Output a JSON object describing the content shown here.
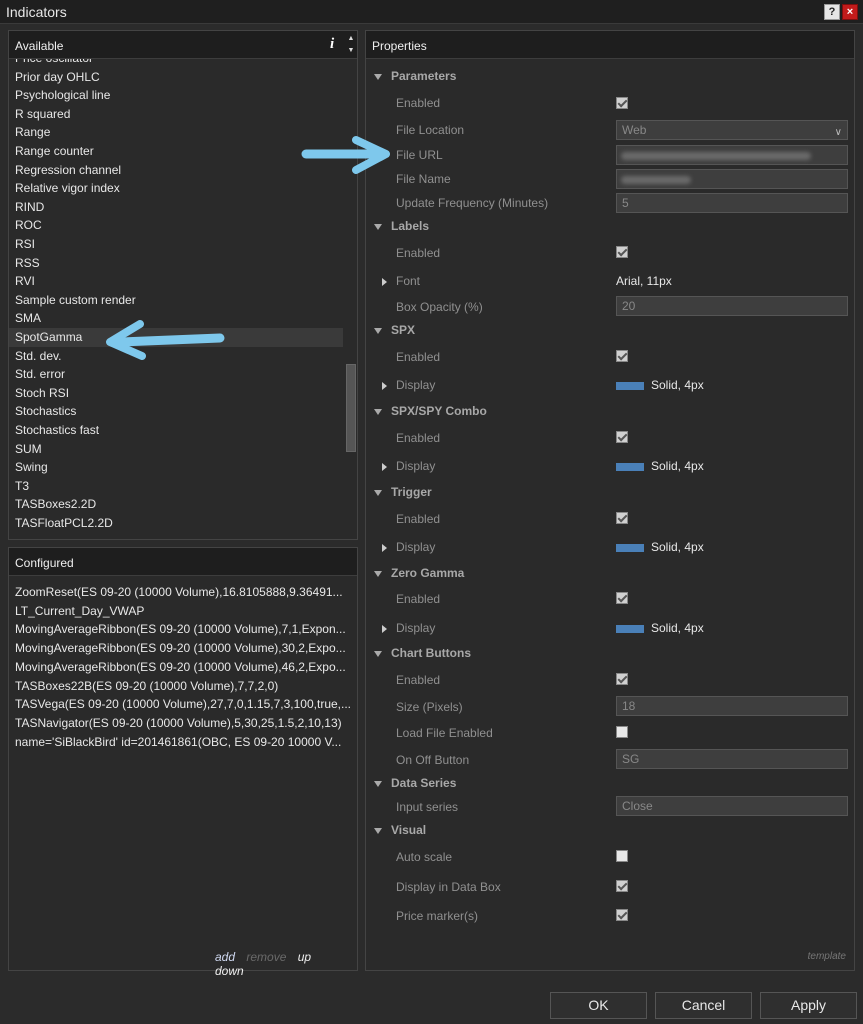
{
  "window": {
    "title": "Indicators",
    "help": "?",
    "close": "×"
  },
  "available": {
    "header": "Available",
    "info": "i",
    "items": [
      "Price oscillator",
      "Prior day OHLC",
      "Psychological line",
      "R squared",
      "Range",
      "Range counter",
      "Regression channel",
      "Relative vigor index",
      "RIND",
      "ROC",
      "RSI",
      "RSS",
      "RVI",
      "Sample custom render",
      "SMA",
      "SpotGamma",
      "Std. dev.",
      "Std. error",
      "Stoch RSI",
      "Stochastics",
      "Stochastics fast",
      "SUM",
      "Swing",
      "T3",
      "TASBoxes2.2D",
      "TASFloatPCL2.2D"
    ],
    "selected": "SpotGamma"
  },
  "configured": {
    "header": "Configured",
    "items": [
      "ZoomReset(ES 09-20 (10000 Volume),16.8105888,9.36491...",
      "LT_Current_Day_VWAP",
      "MovingAverageRibbon(ES 09-20 (10000 Volume),7,1,Expon...",
      "MovingAverageRibbon(ES 09-20 (10000 Volume),30,2,Expo...",
      "MovingAverageRibbon(ES 09-20 (10000 Volume),46,2,Expo...",
      "TASBoxes22B(ES 09-20 (10000 Volume),7,7,2,0)",
      "TASVega(ES 09-20 (10000 Volume),27,7,0,1.15,7,3,100,true,...",
      "TASNavigator(ES 09-20 (10000 Volume),5,30,25,1.5,2,10,13)",
      "name='SiBlackBird' id=201461861(OBC, ES 09-20 10000 V..."
    ],
    "actions": {
      "add": "add",
      "remove": "remove",
      "up": "up",
      "down": "down"
    }
  },
  "properties": {
    "header": "Properties",
    "template": "template",
    "parameters": {
      "title": "Parameters",
      "enabled": "Enabled",
      "file_location": "File Location",
      "file_location_value": "Web",
      "file_url": "File URL",
      "file_name": "File Name",
      "update_frequency": "Update Frequency (Minutes)",
      "update_frequency_value": "5"
    },
    "labels": {
      "title": "Labels",
      "enabled": "Enabled",
      "font": "Font",
      "font_value": "Arial, 11px",
      "box_opacity": "Box Opacity (%)",
      "box_opacity_value": "20"
    },
    "spx": {
      "title": "SPX",
      "enabled": "Enabled",
      "display": "Display",
      "display_value": "Solid, 4px"
    },
    "spx_spy": {
      "title": "SPX/SPY Combo",
      "enabled": "Enabled",
      "display": "Display",
      "display_value": "Solid, 4px"
    },
    "trigger": {
      "title": "Trigger",
      "enabled": "Enabled",
      "display": "Display",
      "display_value": "Solid, 4px"
    },
    "zero_gamma": {
      "title": "Zero Gamma",
      "enabled": "Enabled",
      "display": "Display",
      "display_value": "Solid, 4px"
    },
    "chart_buttons": {
      "title": "Chart Buttons",
      "enabled": "Enabled",
      "size": "Size (Pixels)",
      "size_value": "18",
      "load_file": "Load File Enabled",
      "on_off": "On Off Button",
      "on_off_value": "SG"
    },
    "data_series": {
      "title": "Data Series",
      "input_series": "Input series",
      "input_series_value": "Close"
    },
    "visual": {
      "title": "Visual",
      "auto_scale": "Auto scale",
      "display_data_box": "Display in Data Box",
      "price_markers": "Price marker(s)"
    }
  },
  "buttons": {
    "ok": "OK",
    "cancel": "Cancel",
    "apply": "Apply"
  },
  "colors": {
    "accent": "#4a80b8",
    "arrow": "#7ec8ec",
    "close": "#c21b1b"
  }
}
